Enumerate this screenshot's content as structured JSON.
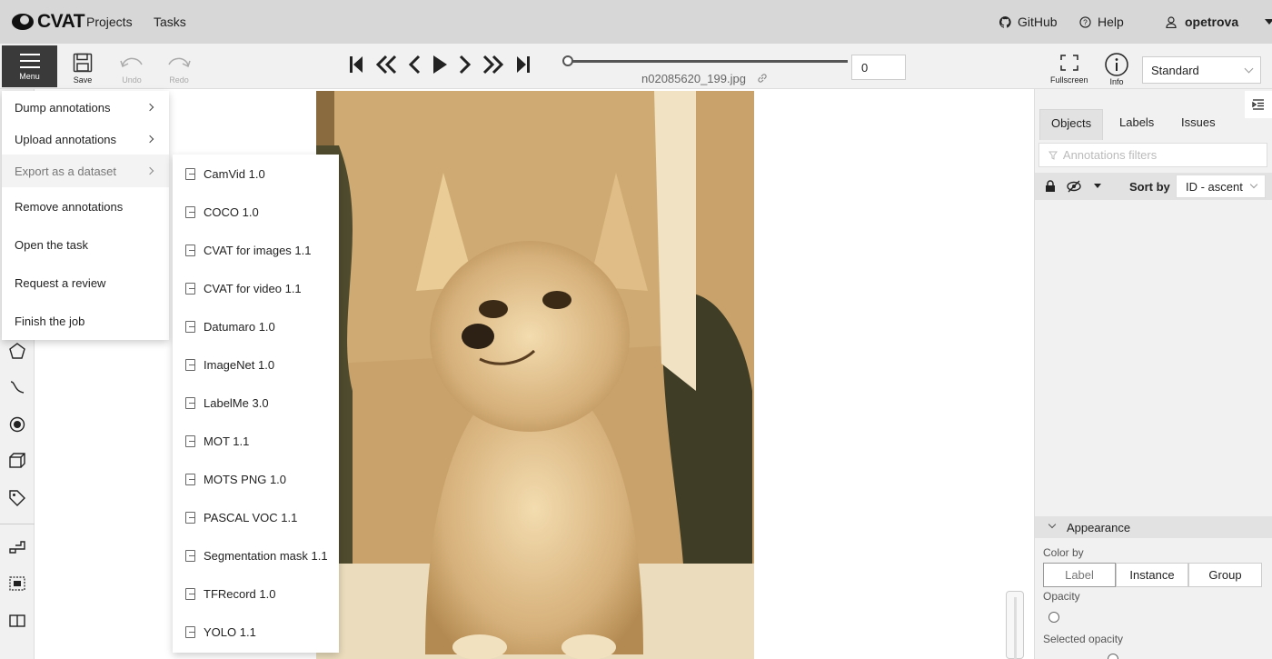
{
  "header": {
    "logo_text": "CVAT",
    "nav": [
      "Projects",
      "Tasks"
    ],
    "github": "GitHub",
    "help": "Help",
    "user": "opetrova"
  },
  "toolbar": {
    "menu_label": "Menu",
    "save_label": "Save",
    "undo_label": "Undo",
    "redo_label": "Redo",
    "filename": "n02085620_199.jpg",
    "frame_value": "0",
    "fullscreen_label": "Fullscreen",
    "info_label": "Info",
    "workspace_value": "Standard"
  },
  "main_menu": {
    "items": [
      {
        "label": "Dump annotations",
        "has_submenu": true
      },
      {
        "label": "Upload annotations",
        "has_submenu": true
      },
      {
        "label": "Export as a dataset",
        "has_submenu": true
      },
      {
        "label": "Remove annotations",
        "has_submenu": false
      },
      {
        "label": "Open the task",
        "has_submenu": false
      },
      {
        "label": "Request a review",
        "has_submenu": false
      },
      {
        "label": "Finish the job",
        "has_submenu": false
      }
    ]
  },
  "export_menu": {
    "formats": [
      "CamVid 1.0",
      "COCO 1.0",
      "CVAT for images 1.1",
      "CVAT for video 1.1",
      "Datumaro 1.0",
      "ImageNet 1.0",
      "LabelMe 3.0",
      "MOT 1.1",
      "MOTS PNG 1.0",
      "PASCAL VOC 1.1",
      "Segmentation mask 1.1",
      "TFRecord 1.0",
      "YOLO 1.1"
    ]
  },
  "sidebar": {
    "tabs": [
      "Objects",
      "Labels",
      "Issues"
    ],
    "filter_placeholder": "Annotations filters",
    "sort_by_label": "Sort by",
    "sort_value": "ID - ascent",
    "appearance_title": "Appearance",
    "color_by_label": "Color by",
    "color_by_options": [
      "Label",
      "Instance",
      "Group"
    ],
    "color_by_selected": "Label",
    "opacity_label": "Opacity",
    "selected_opacity_label": "Selected opacity"
  },
  "colors": {
    "topbar": "#d7d7d7",
    "toolbar": "#f1f1f1",
    "menu_button": "#3a3a3a",
    "photo_tone": "#c49c63"
  }
}
